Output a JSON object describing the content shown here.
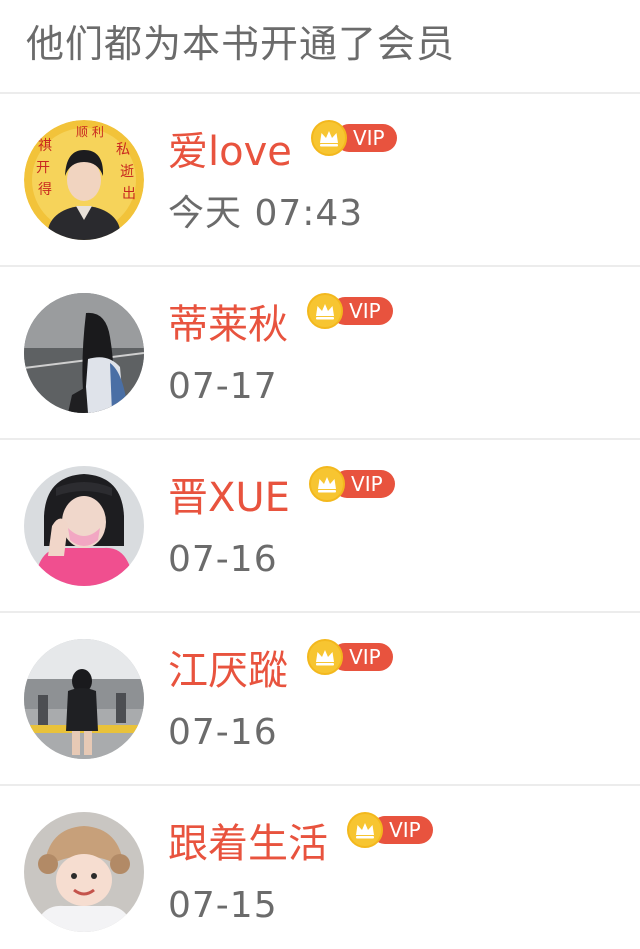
{
  "header": {
    "title": "他们都为本书开通了会员"
  },
  "vip_label": "VIP",
  "colors": {
    "name": "#e8533e",
    "badge": "#e8533e",
    "coin": "#f7c531",
    "meta_text": "#6b6b6b",
    "divider": "#ececec"
  },
  "members": [
    {
      "name": "爱love",
      "time": "今天 07:43",
      "avatar_icon": "photo-avatar-boy-red-poster"
    },
    {
      "name": "蒂莱秋",
      "time": "07-17",
      "avatar_icon": "photo-avatar-girl-street"
    },
    {
      "name": "晋XUE",
      "time": "07-16",
      "avatar_icon": "photo-avatar-girl-pink-hoodie"
    },
    {
      "name": "江厌蹤",
      "time": "07-16",
      "avatar_icon": "photo-avatar-girl-station"
    },
    {
      "name": "跟着生活",
      "time": "07-15",
      "avatar_icon": "photo-avatar-baby-hat"
    }
  ]
}
